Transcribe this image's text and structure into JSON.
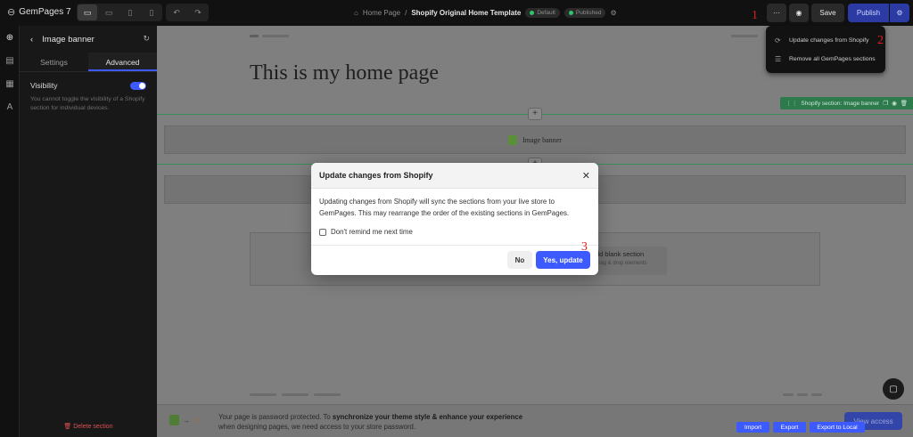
{
  "topbar": {
    "app_name": "GemPages 7",
    "breadcrumb_parent": "Home Page",
    "breadcrumb_sep": "/",
    "page_title": "Shopify Original Home Template",
    "badge_default": "Default",
    "badge_published": "Published",
    "more_label": "···",
    "save_label": "Save",
    "publish_label": "Publish"
  },
  "annotations": {
    "one": "1",
    "two": "2",
    "three": "3"
  },
  "dropdown": {
    "items": [
      {
        "label": "Update changes from Shopify",
        "icon": "sync-icon"
      },
      {
        "label": "Remove all GemPages sections",
        "icon": "remove-icon"
      }
    ]
  },
  "sidebar": {
    "title": "Image banner",
    "tabs": [
      "Settings",
      "Advanced"
    ],
    "active_tab": "Advanced",
    "visibility_label": "Visibility",
    "visibility_note": "You cannot toggle the visibility of a Shopify section for individual devices.",
    "delete_label": "Delete section"
  },
  "canvas": {
    "heading": "This is my home page",
    "section_label": "Shopify section: Image banner",
    "banner_label": "Image banner",
    "add_blank_title": "dd blank section",
    "add_blank_sub": "drag & drop elements",
    "password_line1_pre": "Your page is password protected. To ",
    "password_line1_bold": "synchronize your theme style & enhance your experience",
    "password_line2": "when designing pages, we need access to your store password.",
    "view_access": "View access"
  },
  "bottom_buttons": [
    "Import",
    "Export",
    "Export to Local"
  ],
  "modal": {
    "title": "Update changes from Shopify",
    "body": "Updating changes from Shopify will sync the sections from your live store to GemPages. This may rearrange the order of the existing sections in GemPages.",
    "checkbox_label": "Don't remind me next time",
    "no_label": "No",
    "yes_label": "Yes, update"
  },
  "colors": {
    "accent": "#3d5afe",
    "section_green": "#2d7a4d",
    "annotation_red": "#e02020"
  }
}
